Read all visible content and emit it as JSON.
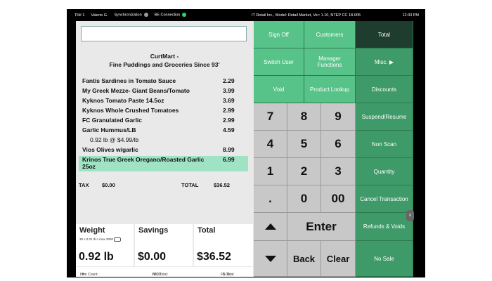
{
  "statusbar": {
    "till": "Till# 1",
    "user": "Valerie G.",
    "sync": "Synchronization",
    "be": "BE Connection",
    "app_info": "IT Retail Inc., Model: Retail Market, Ver: 1.10, NTEP CC 18-005",
    "time": "12:33 PM",
    "colors": {
      "sync_dot": "#9a9a9a",
      "be_dot": "#2bd46e"
    }
  },
  "search": {
    "value": ""
  },
  "receipt": {
    "store_name": "CurtMart -",
    "store_tagline": "Fine Puddings and Groceries Since 93'",
    "items": [
      {
        "name": "Fantis Sardines in Tomato Sauce",
        "price": "2.29"
      },
      {
        "name": "My Greek Mezze- Giant Beans/Tomato",
        "price": "3.99"
      },
      {
        "name": "Kyknos Tomato Paste 14.5oz",
        "price": "3.69"
      },
      {
        "name": "Kyknos Whole Crushed Tomatoes",
        "price": "2.99"
      },
      {
        "name": "FC Granulated Garlic",
        "price": "2.99"
      },
      {
        "name": "Garlic Hummus/LB",
        "price": "4.59"
      },
      {
        "name": "0.92 lb @ $4.99/lb",
        "price": ""
      },
      {
        "name": "Vios Olives w/garlic",
        "price": "8.99"
      },
      {
        "name": "Krinos True Greek Oregano/Roasted Garlic 25oz",
        "price": "6.99"
      }
    ],
    "tax_label": "TAX",
    "tax_value": "$0.00",
    "total_label": "TOTAL",
    "total_value": "$36.52"
  },
  "summary": {
    "weight_title": "Weight",
    "weight_sub": "30 x 0.01 lb n max 3000",
    "weight_value": "0.92 lb",
    "savings_title": "Savings",
    "savings_value": "$0.00",
    "total_title": "Total",
    "total_value": "$36.52"
  },
  "footer": {
    "item_count_label": "Item Count:",
    "item_count": "8",
    "wic_label": "WIC Total:",
    "wic_value": "0.00",
    "fs_label": "FS Total:",
    "fs_value": "0.00"
  },
  "buttons": {
    "sign_off": "Sign Off",
    "customers": "Customers",
    "total": "Total",
    "switch_user": "Switch User",
    "manager_functions": "Manager Functions",
    "misc": "Misc. ▶",
    "void": "Void",
    "product_lookup": "Product Lookup",
    "discounts": "Discounts",
    "suspend_resume": "Suspend/Resume",
    "non_scan": "Non Scan",
    "quantity": "Quantity",
    "cancel_transaction": "Cancel Transaction",
    "refunds_voids": "Refunds & Voids",
    "no_sale": "No Sale",
    "enter": "Enter",
    "back": "Back",
    "clear": "Clear"
  },
  "keypad": [
    "7",
    "8",
    "9",
    "4",
    "5",
    "6",
    "1",
    "2",
    "3",
    ".",
    "0",
    "00"
  ],
  "edge_handle_icon": "chevron-handle-icon"
}
